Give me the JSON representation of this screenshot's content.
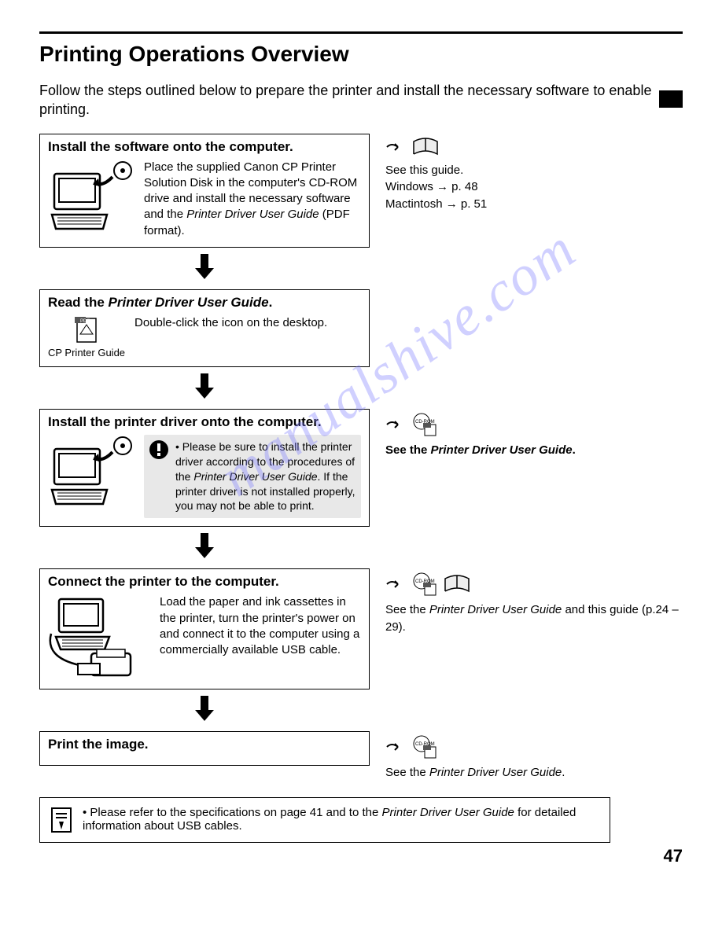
{
  "title": "Printing Operations Overview",
  "intro": "Follow the steps outlined below to prepare the printer and install the necessary software to enable printing.",
  "steps": [
    {
      "title": "Install the software onto the computer.",
      "body_pre": "Place the supplied Canon CP Printer Solution Disk in the computer's CD-ROM drive and install the necessary software and the ",
      "body_italic": "Printer Driver User Guide",
      "body_post": " (PDF format).",
      "side_line1": "See this guide.",
      "side_line2": "Windows → p. 48",
      "side_line3": "Mactintosh → p. 51"
    },
    {
      "title_pre": "Read the ",
      "title_italic": "Printer Driver User Guide",
      "title_post": ".",
      "caption": "CP Printer Guide",
      "body": "Double-click the icon on the desktop."
    },
    {
      "title": "Install the printer driver onto the computer.",
      "body_pre": "Please be sure to install the printer driver according to the procedures of the ",
      "body_italic": "Printer Driver User Guide",
      "body_post": ". If the printer driver is not installed properly, you may not be able to print.",
      "side_pre": "See the ",
      "side_italic": "Printer Driver User Guide",
      "side_post": "."
    },
    {
      "title": "Connect the printer to the computer.",
      "body": "Load the paper and ink cassettes in the printer, turn the printer's power on and connect it to the computer using a commercially available USB cable.",
      "side_pre": "See the ",
      "side_italic": "Printer Driver User Guide",
      "side_post": " and this guide (p.24 – 29)."
    },
    {
      "title": "Print the image.",
      "side_pre": "See the ",
      "side_italic": "Printer Driver User Guide",
      "side_post": "."
    }
  ],
  "note_pre": "Please refer to the specifications on page 41 and to the ",
  "note_italic": "Printer Driver User Guide",
  "note_post": " for detailed information about USB cables.",
  "page_number": "47",
  "watermark": "manualshive.com"
}
